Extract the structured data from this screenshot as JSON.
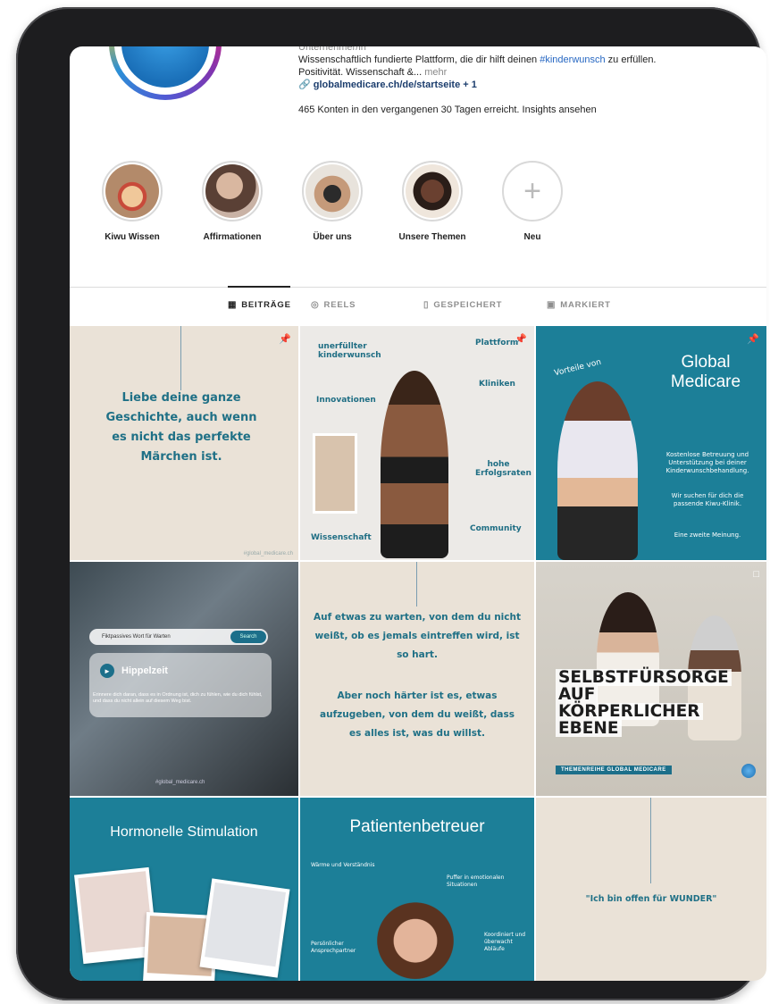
{
  "profile": {
    "category": "Unternehmer/in",
    "bio_line1_pre": "Wissenschaftlich fundierte Plattform, die dir hilft deinen ",
    "bio_hashtag": "#kinderwunsch",
    "bio_line1_post": " zu erfüllen.",
    "bio_line2": "Positivität. Wissenschaft &... ",
    "more": "mehr",
    "link": "globalmedicare.ch/de/startseite + 1",
    "insights": "465 Konten in den vergangenen 30 Tagen erreicht. Insights ansehen"
  },
  "highlights": [
    {
      "label": "Kiwu Wissen"
    },
    {
      "label": "Affirmationen"
    },
    {
      "label": "Über uns"
    },
    {
      "label": "Unsere Themen"
    },
    {
      "label": "Neu"
    }
  ],
  "tabs": [
    {
      "label": "BEITRÄGE",
      "icon": "grid-icon"
    },
    {
      "label": "REELS",
      "icon": "reels-icon"
    },
    {
      "label": "GESPEICHERT",
      "icon": "bookmark-icon"
    },
    {
      "label": "MARKIERT",
      "icon": "tagged-icon"
    }
  ],
  "posts": {
    "p1": {
      "quote": "Liebe deine ganze Geschichte, auch wenn es nicht das perfekte Märchen ist.",
      "handle": "#global_medicare.ch"
    },
    "p2": {
      "labels": {
        "unerfuellter": "unerfüllter kinderwunsch",
        "plattform": "Plattform",
        "kliniken": "Kliniken",
        "innovationen": "Innovationen",
        "hohe": "hohe Erfolgsraten",
        "community": "Community",
        "wissenschaft": "Wissenschaft"
      }
    },
    "p3": {
      "vorteile": "Vorteile von",
      "title": "Global Medicare",
      "t1": "Kostenlose Betreuung und Unterstützung bei deiner Kinderwunschbehandlung.",
      "t2": "Wir suchen für dich die passende Kiwu-Klinik.",
      "t3": "Eine zweite Meinung."
    },
    "p4": {
      "search_placeholder": "Fiktpassives Wort für Warten",
      "search_button": "Search",
      "card_title": "Hippelzeit",
      "body": "Erinnere dich daran, dass es in Ordnung ist, dich zu fühlen, wie du dich fühlst, und dass du nicht allein auf diesem Weg bist.",
      "handle": "#global_medicare.ch"
    },
    "p5": {
      "q1": "Auf etwas zu warten, von dem du nicht weißt, ob es jemals eintreffen wird, ist so hart.",
      "q2": "Aber noch härter ist es, etwas aufzugeben, von dem du weißt, dass es alles ist, was du willst."
    },
    "p6": {
      "l1": "SELBSTFÜRSORGE",
      "l2": "AUF",
      "l3": "KÖRPERLICHER",
      "l4": "EBENE",
      "series": "THEMENREIHE GLOBAL MEDICARE"
    },
    "p7": {
      "title": "Hormonelle Stimulation"
    },
    "p8": {
      "title": "Patientenbetreuer",
      "w": "Wärme und Verständnis",
      "p": "Puffer in emotionalen Situationen",
      "a": "Persönlicher Ansprechpartner",
      "k": "Koordiniert und überwacht Abläufe"
    },
    "p9": {
      "quote": "\"Ich bin offen für WUNDER\""
    }
  },
  "colors": {
    "teal": "#1c7f98",
    "beige": "#eae2d7",
    "text_teal": "#1f7086"
  }
}
